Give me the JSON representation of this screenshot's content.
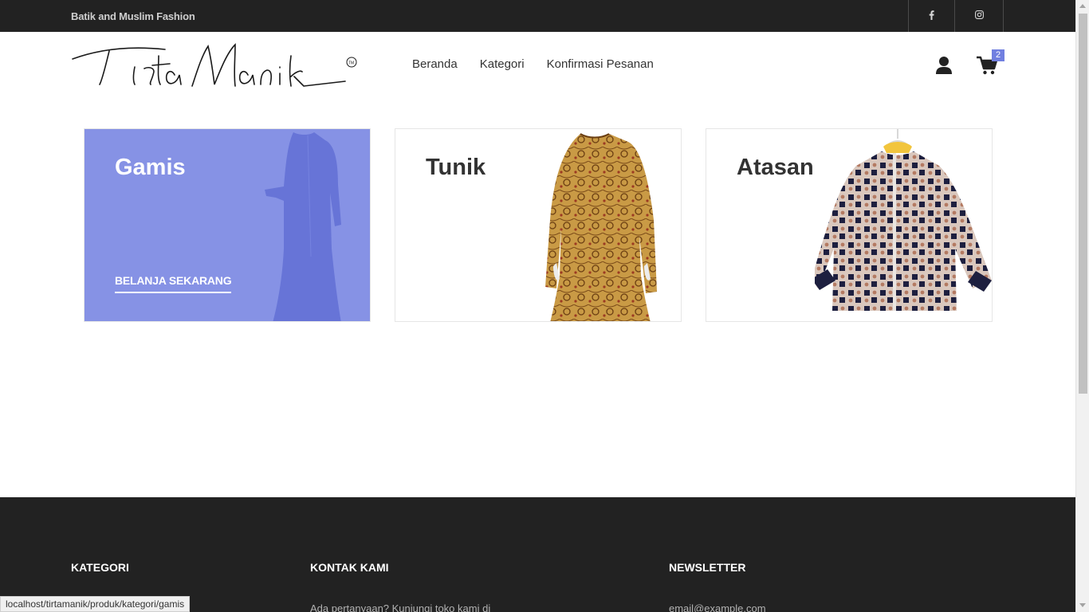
{
  "topbar": {
    "tagline": "Batik and Muslim Fashion",
    "social": [
      {
        "icon": "facebook-icon"
      },
      {
        "icon": "instagram-icon"
      }
    ]
  },
  "header": {
    "logo_text": "Tirta Manik",
    "nav": [
      "Beranda",
      "Kategori",
      "Konfirmasi Pesanan"
    ],
    "cart_count": "2"
  },
  "banners": [
    {
      "title": "Gamis",
      "cta": "BELANJA SEKARANG",
      "image": "dress-image"
    },
    {
      "title": "Tunik",
      "image": "tunic-image"
    },
    {
      "title": "Atasan",
      "image": "blouse-image"
    }
  ],
  "footer": {
    "headings": [
      "KATEGORI",
      "KONTAK KAMI",
      "NEWSLETTER"
    ],
    "contact_text": "Ada pertanyaan? Kunjungi toko kami di",
    "email_placeholder": "email@example.com"
  },
  "status_url": "localhost/tirtamanik/produk/kategori/gamis",
  "colors": {
    "accent": "#717fe0",
    "dark": "#222222"
  }
}
